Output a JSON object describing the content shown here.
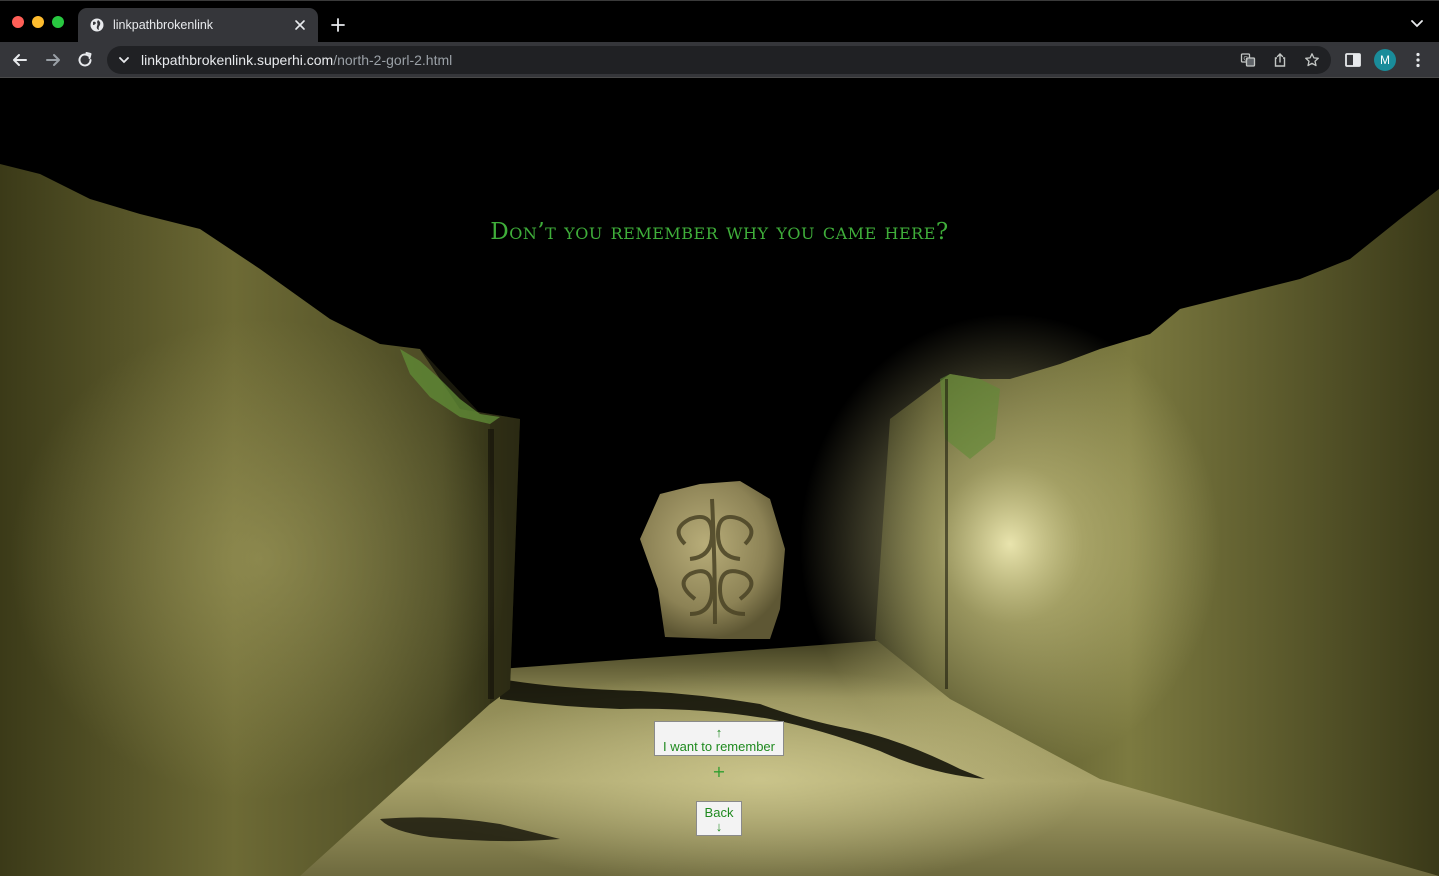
{
  "browser": {
    "tab_title": "linkpathbrokenlink",
    "url_host": "linkpathbrokenlink.superhi.com",
    "url_path": "/north-2-gorl-2.html",
    "profile_initial": "M",
    "icons": [
      "globe-icon",
      "close-icon",
      "plus-icon",
      "chevron-down-icon",
      "back-arrow-icon",
      "forward-arrow-icon",
      "reload-icon",
      "translate-icon",
      "share-icon",
      "star-icon",
      "side-panel-icon",
      "kebab-menu-icon"
    ]
  },
  "page": {
    "headline": "Don’t you remember why you came here?",
    "forward_choice": {
      "arrow": "↑",
      "label": "I want to remember"
    },
    "separator": "+",
    "back_choice": {
      "label": "Back",
      "arrow": "↓"
    },
    "colors": {
      "text_green": "#3fae3a",
      "button_bg": "#f3f3f3",
      "wall_light": "#d9d39a"
    }
  }
}
